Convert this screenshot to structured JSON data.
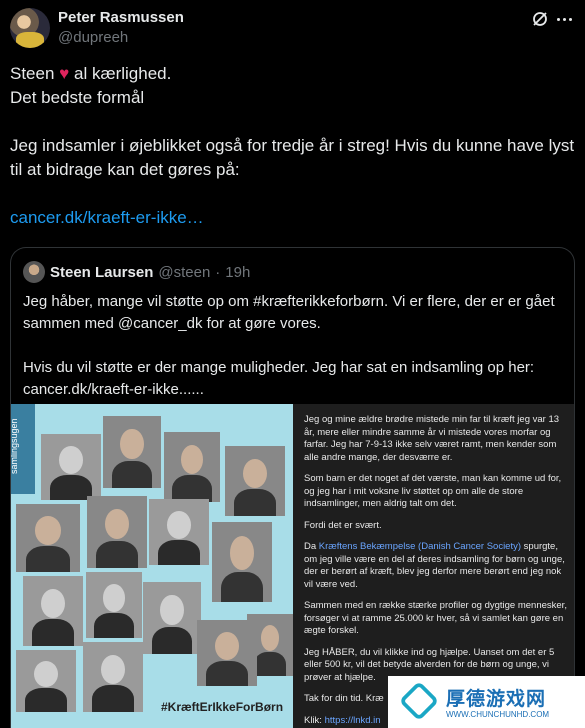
{
  "tweet": {
    "author_name": "Peter Rasmussen",
    "author_handle": "@dupreeh",
    "line1_before": "Steen",
    "line1_heart": "♥",
    "line1_after": "al kærlighed.",
    "line2": "Det bedste formål",
    "paragraph": "Jeg indsamler i øjeblikket også for tredje år i streg! Hvis du kunne have lyst til at bidrage kan det gøres på:",
    "link": "cancer.dk/kraeft-er-ikke…"
  },
  "quote": {
    "author_name": "Steen Laursen",
    "author_handle": "@steen",
    "separator": "·",
    "time": "19h",
    "para1": "Jeg håber, mange vil støtte op om #kræfterikkeforbørn. Vi er flere, der er er gået sammen med @cancer_dk for at gøre vores.",
    "para2": "Hvis du vil støtte er der mange muligheder. Jeg har sat en indsamling op her: cancer.dk/kraeft-er-ikke......"
  },
  "media": {
    "side_tag": "samlingsugen",
    "hashtag": "#KræftErIkkeForBørn",
    "panel": {
      "p1": "Jeg og mine ældre brødre mistede min far til kræft jeg var 13 år, mere eller mindre samme år vi mistede vores morfar og farfar. Jeg har 7-9-13 ikke selv været ramt, men kender som alle andre mange, der desværre er.",
      "p2": "Som barn er det noget af det værste, man kan komme ud for, og jeg har i mit voksne liv støttet op om alle de store indsamlinger, men aldrig talt om det.",
      "p3": "Fordi det er svært.",
      "p4_before": "Da",
      "p4_link": "Kræftens Bekæmpelse (Danish Cancer Society)",
      "p4_after": "spurgte, om jeg ville være en del af deres indsamling for børn og unge, der er berørt af kræft, blev jeg derfor mere berørt end jeg nok vil være ved.",
      "p5": "Sammen med en række stærke profiler og dygtige mennesker, forsøger vi at ramme 25.000 kr hver, så vi samlet kan gøre en ægte forskel.",
      "p6": "Jeg HÅBER, du vil klikke ind og hjælpe. Uanset om det er 5 eller 500 kr, vil det betyde alverden for de børn og unge, vi prøver at hjælpe.",
      "p7": "Tak for din tid. Kræ",
      "p8_before": "Klik:",
      "p8_link": "https://lnkd.in"
    }
  },
  "watermark": {
    "title": "厚德游戏网",
    "url": "WWW.CHUNCHUNHD.COM"
  }
}
